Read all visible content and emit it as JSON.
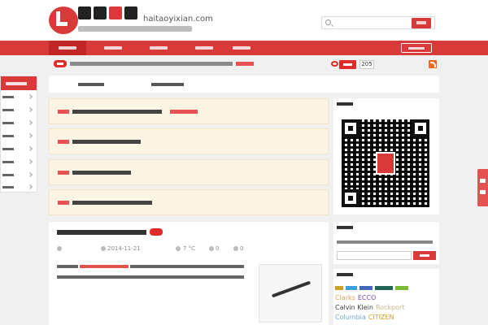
{
  "header": {
    "domain": "haitaoyixian.com",
    "slogan": "",
    "search_placeholder": "",
    "search_button": ""
  },
  "nav": {
    "items": [
      "",
      "",
      "",
      "",
      ""
    ],
    "right_button": ""
  },
  "notice": {
    "hot_badge": "",
    "text": "",
    "link": "",
    "follow_label": "",
    "count": "205"
  },
  "sidebar": {
    "title": "",
    "items": [
      "",
      "",
      "",
      "",
      "",
      "",
      "",
      "",
      ""
    ]
  },
  "tabs": [
    "",
    ""
  ],
  "promos": [
    {
      "tag": "",
      "text": "",
      "highlight": ""
    },
    {
      "tag": "",
      "text": "",
      "highlight": ""
    },
    {
      "tag": "",
      "text": "",
      "highlight": ""
    },
    {
      "tag": "",
      "text": "",
      "highlight": ""
    }
  ],
  "article": {
    "title": "",
    "hot_badge": "",
    "author": "",
    "date": "2014-11-21",
    "temperature": "7 °C",
    "likes": "0",
    "comments": "0",
    "body": ""
  },
  "right": {
    "qr_panel_title": "",
    "subscribe_title": "",
    "subscribe_text": "",
    "subscribe_button": "",
    "tags_title": "",
    "tags_visible": [
      "Clarks",
      "ECCO",
      "Calvin Klein",
      "Rockport",
      "Columbia",
      "CITIZEN"
    ]
  },
  "share": {
    "label": ""
  },
  "colors": {
    "brand_red": "#d83a3a",
    "notice_bg": "#fdf5e4"
  }
}
